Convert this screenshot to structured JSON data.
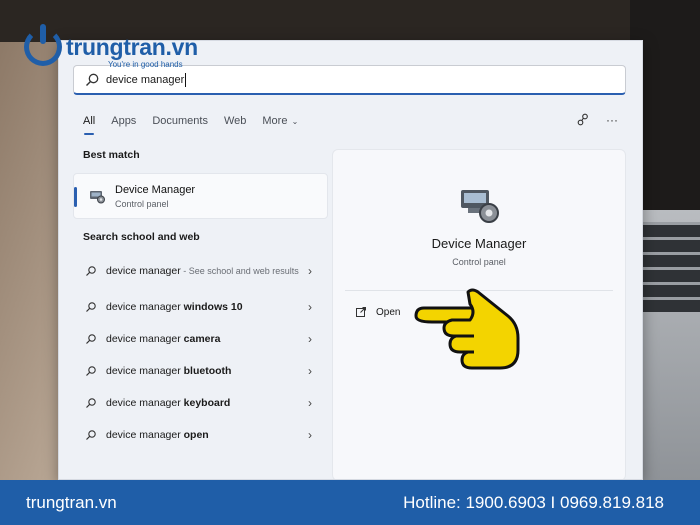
{
  "logo": {
    "brand": "trungtran.vn",
    "tagline": "You're in good hands"
  },
  "search": {
    "value": "device manager"
  },
  "tabs": [
    {
      "label": "All",
      "active": true
    },
    {
      "label": "Apps"
    },
    {
      "label": "Documents"
    },
    {
      "label": "Web"
    },
    {
      "label": "More"
    }
  ],
  "tools": {
    "share_icon": "share-icon",
    "more_icon": "ellipsis-icon"
  },
  "best_match": {
    "section_title": "Best match",
    "name": "Device Manager",
    "sub": "Control panel"
  },
  "web": {
    "section_title": "Search school and web",
    "results": [
      {
        "prefix": "device manager",
        "bold": "",
        "hint": " - See school and web results"
      },
      {
        "prefix": "device manager ",
        "bold": "windows 10",
        "hint": ""
      },
      {
        "prefix": "device manager ",
        "bold": "camera",
        "hint": ""
      },
      {
        "prefix": "device manager ",
        "bold": "bluetooth",
        "hint": ""
      },
      {
        "prefix": "device manager ",
        "bold": "keyboard",
        "hint": ""
      },
      {
        "prefix": "device manager ",
        "bold": "open",
        "hint": ""
      }
    ]
  },
  "preview": {
    "title": "Device Manager",
    "subtitle": "Control panel",
    "open_label": "Open"
  },
  "footer": {
    "site": "trungtran.vn",
    "hotline": "Hotline: 1900.6903  I  0969.819.818"
  },
  "colors": {
    "brand_blue": "#1f5ea8",
    "accent": "#2a5fb0",
    "hand_yellow": "#f3d400"
  }
}
